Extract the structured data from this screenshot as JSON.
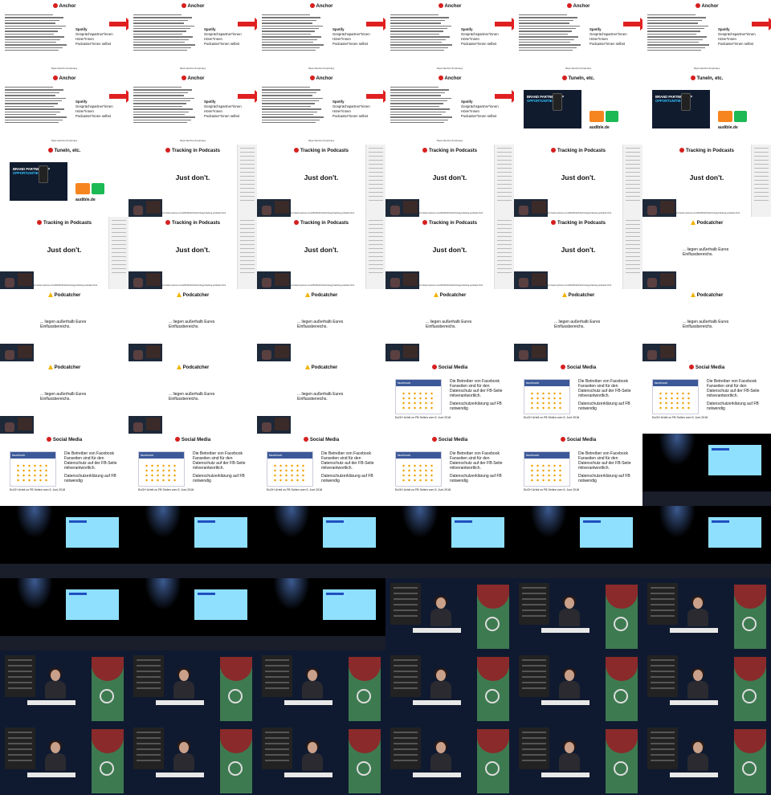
{
  "slides": {
    "anchor": {
      "title": "Anchor",
      "side_title": "Spotify",
      "side_items": [
        "Gesprächspartner*innen",
        "Hörer*innen",
        "Podcaster*innen selbst"
      ],
      "url": "https://anchor.fm/privacy"
    },
    "tunein": {
      "title": "TuneIn, etc.",
      "promo_line1": "BRAND PARTNERSHIP",
      "promo_line2": "OPPORTUNITIES",
      "audible": "audible.de"
    },
    "tracking": {
      "title": "Tracking in Podcasts",
      "text": "Just don't.",
      "url": "https://www.nytimes.com/2019/04/21/technology/tracking-podcasts.html"
    },
    "podcatcher": {
      "title": "Podcatcher",
      "text1": "... liegen außerhalb Eures",
      "text2": "Einflussbereichs."
    },
    "social": {
      "title": "Social Media",
      "fb_label": "facebook",
      "line1": "Die Betreiber von Facebook",
      "line2": "Fanseiten sind für den",
      "line3": "Datenschutz auf der FB-Seite",
      "line4": "mitverantwortlich.",
      "line5": "Datenschutzerklärung auf FB",
      "line6": "notwendig",
      "caption": "EuGH Urteil zu FB Seiten vom 5. Juni 2018"
    }
  },
  "grid": {
    "columns": 6,
    "tiles": [
      "anchor",
      "anchor",
      "anchor",
      "anchor",
      "anchor",
      "anchor",
      "anchor",
      "anchor",
      "anchor",
      "anchor",
      "tunein",
      "tunein",
      "tunein",
      "tracking",
      "tracking",
      "tracking",
      "tracking",
      "tracking",
      "tracking",
      "tracking",
      "tracking",
      "tracking",
      "tracking",
      "podcatcher",
      "podcatcher",
      "podcatcher",
      "podcatcher",
      "podcatcher",
      "podcatcher",
      "podcatcher",
      "podcatcher",
      "podcatcher",
      "podcatcher",
      "social",
      "social",
      "social",
      "social",
      "social",
      "social",
      "social",
      "social",
      "stage",
      "stage",
      "stage",
      "stage",
      "stage",
      "stage",
      "stage",
      "stage",
      "stage",
      "stage",
      "speaker",
      "speaker",
      "speaker",
      "speaker",
      "speaker",
      "speaker",
      "speaker",
      "speaker",
      "speaker",
      "speaker",
      "speaker",
      "speaker",
      "speaker",
      "speaker",
      "speaker"
    ]
  }
}
